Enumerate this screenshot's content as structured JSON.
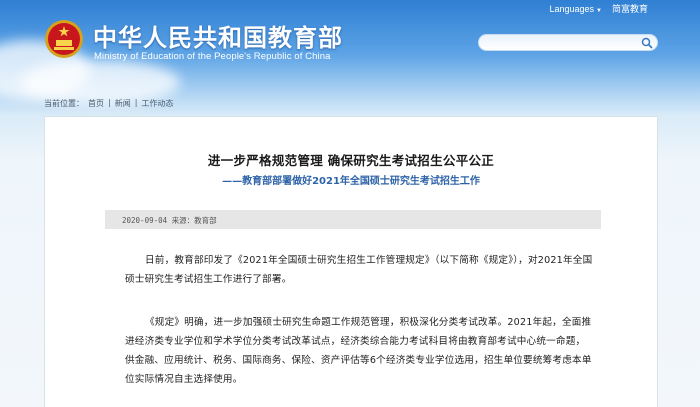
{
  "header": {
    "title": "中华人民共和国教育部",
    "subtitle": "Ministry of Education of the People's Republic of China",
    "nav": {
      "languages": "Languages",
      "accessibility": "简富教育"
    },
    "search": {
      "placeholder": ""
    }
  },
  "breadcrumb": {
    "label": "当前位置：",
    "items": [
      "首页",
      "新闻",
      "工作动态"
    ],
    "separator": "|"
  },
  "article": {
    "title": "进一步严格规范管理 确保研究生考试招生公平公正",
    "subtitle": "——教育部部署做好2021年全国硕士研究生考试招生工作",
    "meta": "2020-09-04 来源：教育部",
    "paragraphs": [
      "日前，教育部印发了《2021年全国硕士研究生招生工作管理规定》（以下简称《规定》），对2021年全国硕士研究生考试招生工作进行了部署。",
      "《规定》明确，进一步加强硕士研究生命题工作规范管理，积极深化分类考试改革。2021年起，全面推进经济类专业学位和学术学位分类考试改革试点，经济类综合能力考试科目将由教育部考试中心统一命题，供金融、应用统计、税务、国际商务、保险、资产评估等6个经济类专业学位选用，招生单位要统筹考虑本单位实际情况自主选择使用。"
    ]
  },
  "colors": {
    "header_blue": "#2f7fd3",
    "subtitle_blue": "#2e63a8"
  },
  "icons": [
    "national-emblem-icon",
    "search-icon"
  ]
}
